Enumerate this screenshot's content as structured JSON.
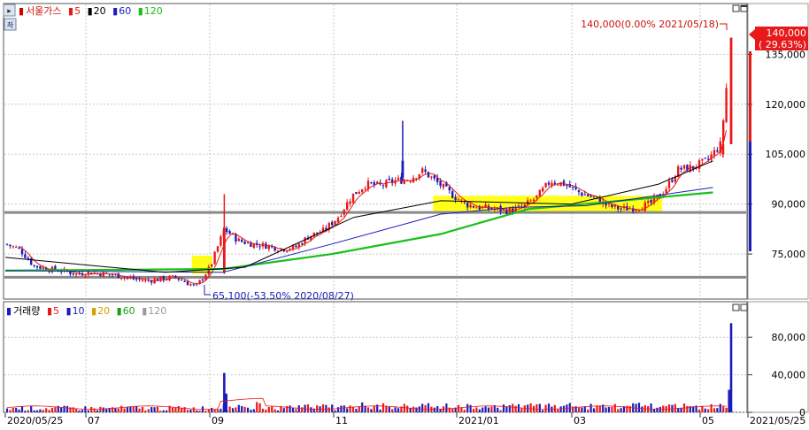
{
  "price_panel": {
    "stock_name": "서울가스",
    "ma_legend": [
      {
        "label": "5",
        "color": "#e8191a"
      },
      {
        "label": "20",
        "color": "#000000"
      },
      {
        "label": "60",
        "color": "#1c1cbb"
      },
      {
        "label": "120",
        "color": "#18c018"
      }
    ],
    "high_annotation": "140,000(0.00% 2021/05/18)",
    "low_annotation": "65,100(-53.50% 2020/08/27)",
    "current_price": "140,000",
    "current_change": "( 29.63%)",
    "y_ticks": [
      "75,000",
      "90,000",
      "105,000",
      "120,000",
      "135,000"
    ],
    "y_tick_values": [
      75000,
      90000,
      105000,
      120000,
      135000
    ]
  },
  "volume_panel": {
    "title": "거래량",
    "ma_legend": [
      {
        "label": "5",
        "color": "#e8191a"
      },
      {
        "label": "10",
        "color": "#1c1cbb"
      },
      {
        "label": "20",
        "color": "#d4a000"
      },
      {
        "label": "60",
        "color": "#18a018"
      },
      {
        "label": "120",
        "color": "#999999"
      }
    ],
    "y_ticks": [
      "0",
      "40,000",
      "80,000"
    ],
    "y_tick_values": [
      0,
      40000,
      80000
    ]
  },
  "x_axis": {
    "labels": [
      "2020/05/25",
      "07",
      "09",
      "11",
      "2021/01",
      "03",
      "05",
      "2021/05/25"
    ]
  },
  "chart_data": {
    "type": "candlestick",
    "title": "서울가스",
    "price_ylim": [
      62000,
      146000
    ],
    "volume_ylim": [
      0,
      100000
    ],
    "support_lines": [
      87500,
      68000
    ],
    "highlight_zones": [
      {
        "from": "2020/08/25",
        "to": "2020/09/04",
        "low": 69000,
        "high": 74500
      },
      {
        "from": "2020/12/22",
        "to": "2021/04/14",
        "low": 87500,
        "high": 92500
      }
    ],
    "close_profile": [
      [
        "2020/05/25",
        78000
      ],
      [
        "2020/06/01",
        76500
      ],
      [
        "2020/06/08",
        71500
      ],
      [
        "2020/06/15",
        70500
      ],
      [
        "2020/06/22",
        70000
      ],
      [
        "2020/06/29",
        69000
      ],
      [
        "2020/07/06",
        69500
      ],
      [
        "2020/07/13",
        69000
      ],
      [
        "2020/07/20",
        68500
      ],
      [
        "2020/07/27",
        67500
      ],
      [
        "2020/08/03",
        67000
      ],
      [
        "2020/08/10",
        67500
      ],
      [
        "2020/08/17",
        68000
      ],
      [
        "2020/08/27",
        65100
      ],
      [
        "2020/09/03",
        71000
      ],
      [
        "2020/09/10",
        82500
      ],
      [
        "2020/09/17",
        79000
      ],
      [
        "2020/09/24",
        78000
      ],
      [
        "2020/10/01",
        77500
      ],
      [
        "2020/10/08",
        76500
      ],
      [
        "2020/10/15",
        77000
      ],
      [
        "2020/10/22",
        80500
      ],
      [
        "2020/10/29",
        82000
      ],
      [
        "2020/11/05",
        86000
      ],
      [
        "2020/11/12",
        92500
      ],
      [
        "2020/11/19",
        96000
      ],
      [
        "2020/11/26",
        95500
      ],
      [
        "2020/12/03",
        97000
      ],
      [
        "2020/12/10",
        97500
      ],
      [
        "2020/12/17",
        100000
      ],
      [
        "2020/12/24",
        96500
      ],
      [
        "2020/12/31",
        93000
      ],
      [
        "2021/01/07",
        90000
      ],
      [
        "2021/01/14",
        89000
      ],
      [
        "2021/01/21",
        88500
      ],
      [
        "2021/01/28",
        88000
      ],
      [
        "2021/02/04",
        89000
      ],
      [
        "2021/02/11",
        92000
      ],
      [
        "2021/02/18",
        97000
      ],
      [
        "2021/02/25",
        96000
      ],
      [
        "2021/03/04",
        93500
      ],
      [
        "2021/03/11",
        92000
      ],
      [
        "2021/03/18",
        89500
      ],
      [
        "2021/03/25",
        88500
      ],
      [
        "2021/04/01",
        89000
      ],
      [
        "2021/04/08",
        90000
      ],
      [
        "2021/04/15",
        94000
      ],
      [
        "2021/04/22",
        100500
      ],
      [
        "2021/04/29",
        101000
      ],
      [
        "2021/05/06",
        103000
      ],
      [
        "2021/05/13",
        108000
      ],
      [
        "2021/05/18",
        140000
      ]
    ],
    "ma_profile": {
      "ma20": [
        [
          0,
          74000
        ],
        [
          0.22,
          69500
        ],
        [
          0.33,
          71000
        ],
        [
          0.48,
          86000
        ],
        [
          0.6,
          91000
        ],
        [
          0.78,
          90000
        ],
        [
          0.9,
          96000
        ],
        [
          0.975,
          103000
        ]
      ],
      "ma60": [
        [
          0,
          70000
        ],
        [
          0.3,
          69500
        ],
        [
          0.45,
          78000
        ],
        [
          0.6,
          87000
        ],
        [
          0.7,
          89000
        ],
        [
          0.8,
          89500
        ],
        [
          0.975,
          95000
        ]
      ],
      "ma120": [
        [
          0,
          70000
        ],
        [
          0.3,
          70500
        ],
        [
          0.45,
          75000
        ],
        [
          0.6,
          81000
        ],
        [
          0.72,
          88500
        ],
        [
          0.975,
          93500
        ]
      ]
    },
    "volume_spikes": [
      [
        "2020/09/10",
        42000
      ],
      [
        "2020/09/11",
        20000
      ],
      [
        "2021/05/17",
        24000
      ],
      [
        "2021/05/18",
        95000
      ]
    ]
  }
}
